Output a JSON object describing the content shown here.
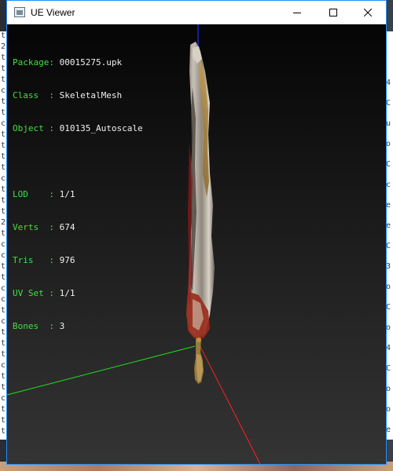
{
  "window": {
    "title": "UE Viewer"
  },
  "info": {
    "package_label": "Package: ",
    "package_value": "00015275.upk",
    "class_label": "Class  : ",
    "class_value": "SkeletalMesh",
    "object_label": "Object : ",
    "object_value": "010135_Autoscale",
    "lod_label": "LOD    : ",
    "lod_value": "1/1",
    "verts_label": "Verts  : ",
    "verts_value": "674",
    "tris_label": "Tris   : ",
    "tris_value": "976",
    "uvset_label": "UV Set : ",
    "uvset_value": "1/1",
    "bones_label": "Bones  : ",
    "bones_value": "3"
  },
  "colors": {
    "label_green": "#40e040",
    "value_white": "#f0f0f0",
    "axis_x": "#ff2020",
    "axis_y": "#20e020",
    "axis_z": "#2030ff"
  },
  "icons": {
    "minimize": "minimize-icon",
    "maximize": "maximize-icon",
    "close": "close-icon",
    "app": "app-window-icon"
  },
  "background_console": {
    "left_chars": [
      "t",
      "2",
      "t",
      "t",
      "t",
      "c",
      "t",
      "t",
      "c",
      "t",
      "t",
      "t",
      "t",
      "c",
      "t",
      "t",
      "t",
      "2",
      "t",
      "c",
      "c",
      "t",
      "t",
      "c",
      "c",
      "t",
      "c",
      "t",
      "t",
      "t",
      "c",
      "t",
      "t",
      "c",
      "t",
      "t",
      "t"
    ],
    "right_chars": [
      "4",
      "C",
      "u",
      "o",
      "C",
      "c",
      "e",
      "e",
      "C",
      "3",
      "o",
      "C",
      "o",
      "4",
      "C",
      "o",
      "o",
      "e"
    ]
  }
}
